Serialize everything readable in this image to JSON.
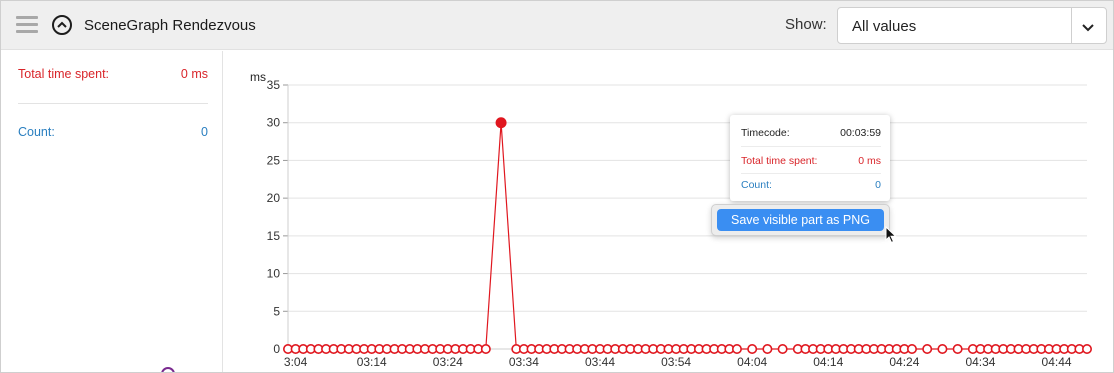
{
  "header": {
    "title": "SceneGraph Rendezvous",
    "show_label": "Show:",
    "show_selected": "All values"
  },
  "sidebar": {
    "total_label": "Total time spent:",
    "total_value": "0 ms",
    "count_label": "Count:",
    "count_value": "0"
  },
  "tooltip": {
    "timecode_label": "Timecode:",
    "timecode_value": "00:03:59",
    "total_label": "Total time spent:",
    "total_value": "0 ms",
    "count_label": "Count:",
    "count_value": "0"
  },
  "context_menu": {
    "item": "Save visible part as PNG"
  },
  "colors": {
    "series": "#e0171f",
    "count": "#2a7fc0",
    "menu_highlight": "#3a8ef2"
  },
  "icons": [
    "hamburger-icon",
    "collapse-up-icon",
    "chevron-down-icon",
    "cursor-arrow-icon"
  ],
  "chart_data": {
    "type": "line",
    "ylabel": "ms",
    "ylim": [
      0,
      35
    ],
    "yticks": [
      0,
      5,
      10,
      15,
      20,
      25,
      30,
      35
    ],
    "xticks": [
      "3:04",
      "03:14",
      "03:24",
      "03:34",
      "03:44",
      "03:54",
      "04:04",
      "04:14",
      "04:24",
      "04:34",
      "04:44"
    ],
    "xlim_seconds": [
      183,
      288
    ],
    "grid": true,
    "series": [
      {
        "marker": "open-circle",
        "spike": {
          "x": "03:31",
          "y": 30
        },
        "baseline_y": 0,
        "points": [
          {
            "x": 183,
            "y": 0
          },
          {
            "x": 184,
            "y": 0
          },
          {
            "x": 185,
            "y": 0
          },
          {
            "x": 186,
            "y": 0
          },
          {
            "x": 187,
            "y": 0
          },
          {
            "x": 188,
            "y": 0
          },
          {
            "x": 189,
            "y": 0
          },
          {
            "x": 190,
            "y": 0
          },
          {
            "x": 191,
            "y": 0
          },
          {
            "x": 192,
            "y": 0
          },
          {
            "x": 193,
            "y": 0
          },
          {
            "x": 194,
            "y": 0
          },
          {
            "x": 195,
            "y": 0
          },
          {
            "x": 196,
            "y": 0
          },
          {
            "x": 197,
            "y": 0
          },
          {
            "x": 198,
            "y": 0
          },
          {
            "x": 199,
            "y": 0
          },
          {
            "x": 200,
            "y": 0
          },
          {
            "x": 201,
            "y": 0
          },
          {
            "x": 202,
            "y": 0
          },
          {
            "x": 203,
            "y": 0
          },
          {
            "x": 204,
            "y": 0
          },
          {
            "x": 205,
            "y": 0
          },
          {
            "x": 206,
            "y": 0
          },
          {
            "x": 207,
            "y": 0
          },
          {
            "x": 208,
            "y": 0
          },
          {
            "x": 209,
            "y": 0
          },
          {
            "x": 211,
            "y": 30
          },
          {
            "x": 213,
            "y": 0
          },
          {
            "x": 214,
            "y": 0
          },
          {
            "x": 215,
            "y": 0
          },
          {
            "x": 216,
            "y": 0
          },
          {
            "x": 217,
            "y": 0
          },
          {
            "x": 218,
            "y": 0
          },
          {
            "x": 219,
            "y": 0
          },
          {
            "x": 220,
            "y": 0
          },
          {
            "x": 221,
            "y": 0
          },
          {
            "x": 222,
            "y": 0
          },
          {
            "x": 223,
            "y": 0
          },
          {
            "x": 224,
            "y": 0
          },
          {
            "x": 225,
            "y": 0
          },
          {
            "x": 226,
            "y": 0
          },
          {
            "x": 227,
            "y": 0
          },
          {
            "x": 228,
            "y": 0
          },
          {
            "x": 229,
            "y": 0
          },
          {
            "x": 230,
            "y": 0
          },
          {
            "x": 231,
            "y": 0
          },
          {
            "x": 232,
            "y": 0
          },
          {
            "x": 233,
            "y": 0
          },
          {
            "x": 234,
            "y": 0
          },
          {
            "x": 235,
            "y": 0
          },
          {
            "x": 236,
            "y": 0
          },
          {
            "x": 237,
            "y": 0
          },
          {
            "x": 238,
            "y": 0
          },
          {
            "x": 239,
            "y": 0
          },
          {
            "x": 240,
            "y": 0
          },
          {
            "x": 241,
            "y": 0
          },
          {
            "x": 242,
            "y": 0
          },
          {
            "x": 244,
            "y": 0
          },
          {
            "x": 246,
            "y": 0
          },
          {
            "x": 248,
            "y": 0
          },
          {
            "x": 250,
            "y": 0
          },
          {
            "x": 251,
            "y": 0
          },
          {
            "x": 252,
            "y": 0
          },
          {
            "x": 253,
            "y": 0
          },
          {
            "x": 254,
            "y": 0
          },
          {
            "x": 255,
            "y": 0
          },
          {
            "x": 256,
            "y": 0
          },
          {
            "x": 257,
            "y": 0
          },
          {
            "x": 258,
            "y": 0
          },
          {
            "x": 259,
            "y": 0
          },
          {
            "x": 260,
            "y": 0
          },
          {
            "x": 261,
            "y": 0
          },
          {
            "x": 262,
            "y": 0
          },
          {
            "x": 263,
            "y": 0
          },
          {
            "x": 264,
            "y": 0
          },
          {
            "x": 265,
            "y": 0
          },
          {
            "x": 267,
            "y": 0
          },
          {
            "x": 269,
            "y": 0
          },
          {
            "x": 271,
            "y": 0
          },
          {
            "x": 273,
            "y": 0
          },
          {
            "x": 274,
            "y": 0
          },
          {
            "x": 275,
            "y": 0
          },
          {
            "x": 276,
            "y": 0
          },
          {
            "x": 277,
            "y": 0
          },
          {
            "x": 278,
            "y": 0
          },
          {
            "x": 279,
            "y": 0
          },
          {
            "x": 280,
            "y": 0
          },
          {
            "x": 281,
            "y": 0
          },
          {
            "x": 282,
            "y": 0
          },
          {
            "x": 283,
            "y": 0
          },
          {
            "x": 284,
            "y": 0
          },
          {
            "x": 285,
            "y": 0
          },
          {
            "x": 286,
            "y": 0
          },
          {
            "x": 287,
            "y": 0
          },
          {
            "x": 288,
            "y": 0
          }
        ]
      }
    ]
  }
}
